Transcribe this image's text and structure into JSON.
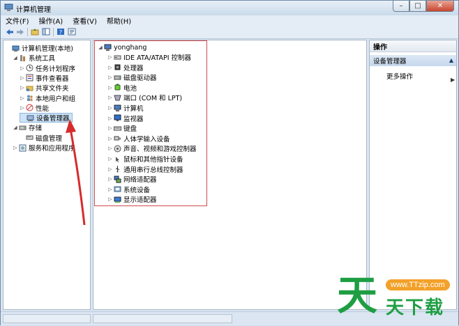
{
  "window": {
    "title": "计算机管理"
  },
  "caption": {
    "min": "–",
    "max": "□",
    "close": "✕"
  },
  "menu": [
    "文件(F)",
    "操作(A)",
    "查看(V)",
    "帮助(H)"
  ],
  "left_tree": [
    {
      "label": "计算机管理(本地)",
      "icon": "computer-management-icon",
      "level": 0,
      "expander": ""
    },
    {
      "label": "系统工具",
      "icon": "system-tools-icon",
      "level": 1,
      "expander": "◢"
    },
    {
      "label": "任务计划程序",
      "icon": "task-scheduler-icon",
      "level": 2,
      "expander": "▷"
    },
    {
      "label": "事件查看器",
      "icon": "event-viewer-icon",
      "level": 2,
      "expander": "▷"
    },
    {
      "label": "共享文件夹",
      "icon": "shared-folders-icon",
      "level": 2,
      "expander": "▷"
    },
    {
      "label": "本地用户和组",
      "icon": "local-users-icon",
      "level": 2,
      "expander": "▷"
    },
    {
      "label": "性能",
      "icon": "performance-icon",
      "level": 2,
      "expander": "▷"
    },
    {
      "label": "设备管理器",
      "icon": "device-manager-icon",
      "level": 2,
      "expander": "",
      "selected": true
    },
    {
      "label": "存储",
      "icon": "storage-icon",
      "level": 1,
      "expander": "◢"
    },
    {
      "label": "磁盘管理",
      "icon": "disk-management-icon",
      "level": 2,
      "expander": ""
    },
    {
      "label": "服务和应用程序",
      "icon": "services-apps-icon",
      "level": 1,
      "expander": "▷"
    }
  ],
  "device_tree": {
    "root": {
      "label": "yonghang",
      "icon": "computer-icon"
    },
    "items": [
      {
        "label": "IDE ATA/ATAPI 控制器",
        "icon": "ide-controller-icon"
      },
      {
        "label": "处理器",
        "icon": "processor-icon"
      },
      {
        "label": "磁盘驱动器",
        "icon": "disk-drive-icon"
      },
      {
        "label": "电池",
        "icon": "battery-icon"
      },
      {
        "label": "端口 (COM 和 LPT)",
        "icon": "port-icon"
      },
      {
        "label": "计算机",
        "icon": "computer-icon"
      },
      {
        "label": "监视器",
        "icon": "monitor-icon"
      },
      {
        "label": "键盘",
        "icon": "keyboard-icon"
      },
      {
        "label": "人体学输入设备",
        "icon": "hid-icon"
      },
      {
        "label": "声音、视频和游戏控制器",
        "icon": "sound-icon"
      },
      {
        "label": "鼠标和其他指针设备",
        "icon": "mouse-icon"
      },
      {
        "label": "通用串行总线控制器",
        "icon": "usb-icon"
      },
      {
        "label": "网络适配器",
        "icon": "network-adapter-icon"
      },
      {
        "label": "系统设备",
        "icon": "system-devices-icon"
      },
      {
        "label": "显示适配器",
        "icon": "display-adapter-icon"
      }
    ]
  },
  "actions": {
    "header": "操作",
    "section": "设备管理器",
    "more": "更多操作"
  },
  "watermark": {
    "big": "天",
    "url": "www.TTzip.com",
    "small": "天下载"
  },
  "colors": {
    "highlight": "#d04a4a",
    "arrow": "#d62b2b",
    "watermark_green": "#1e9e43",
    "watermark_orange": "#f3a12a"
  }
}
